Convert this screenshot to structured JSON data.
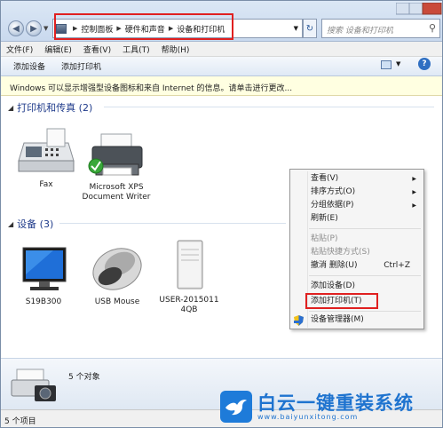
{
  "address": {
    "breadcrumbs": [
      "控制面板",
      "硬件和声音",
      "设备和打印机"
    ],
    "search_placeholder": "搜索 设备和打印机"
  },
  "menubar": [
    "文件(F)",
    "编辑(E)",
    "查看(V)",
    "工具(T)",
    "帮助(H)"
  ],
  "commandbar": [
    "添加设备",
    "添加打印机"
  ],
  "infobar": "Windows 可以显示增强型设备图标和来自 Internet 的信息。请单击进行更改...",
  "groups": {
    "printers": "打印机和传真 (2)",
    "devices": "设备 (3)"
  },
  "printers": [
    {
      "label": "Fax",
      "icon": "fax-icon"
    },
    {
      "label": "Microsoft XPS Document Writer",
      "icon": "printer-icon"
    }
  ],
  "devices": [
    {
      "label": "S19B300",
      "icon": "monitor-icon"
    },
    {
      "label": "USB Mouse",
      "icon": "mouse-icon"
    },
    {
      "label": "USER-20150114QB",
      "icon": "computer-icon"
    }
  ],
  "context_menu": {
    "view": "查看(V)",
    "sort": "排序方式(O)",
    "group": "分组依据(P)",
    "refresh": "刷新(E)",
    "paste": "粘贴(P)",
    "paste_shortcut": "粘贴快捷方式(S)",
    "undo": "撤消 删除(U)",
    "undo_shortcut": "Ctrl+Z",
    "add_device": "添加设备(D)",
    "add_printer": "添加打印机(T)",
    "device_manager": "设备管理器(M)"
  },
  "details": {
    "count": "5 个对象"
  },
  "status": "5 个项目",
  "watermark": {
    "name": "白云一键重装系统",
    "url": "www.baiyunxitong.com"
  },
  "colors": {
    "highlight": "#e02020",
    "brand": "#1e73cf"
  }
}
